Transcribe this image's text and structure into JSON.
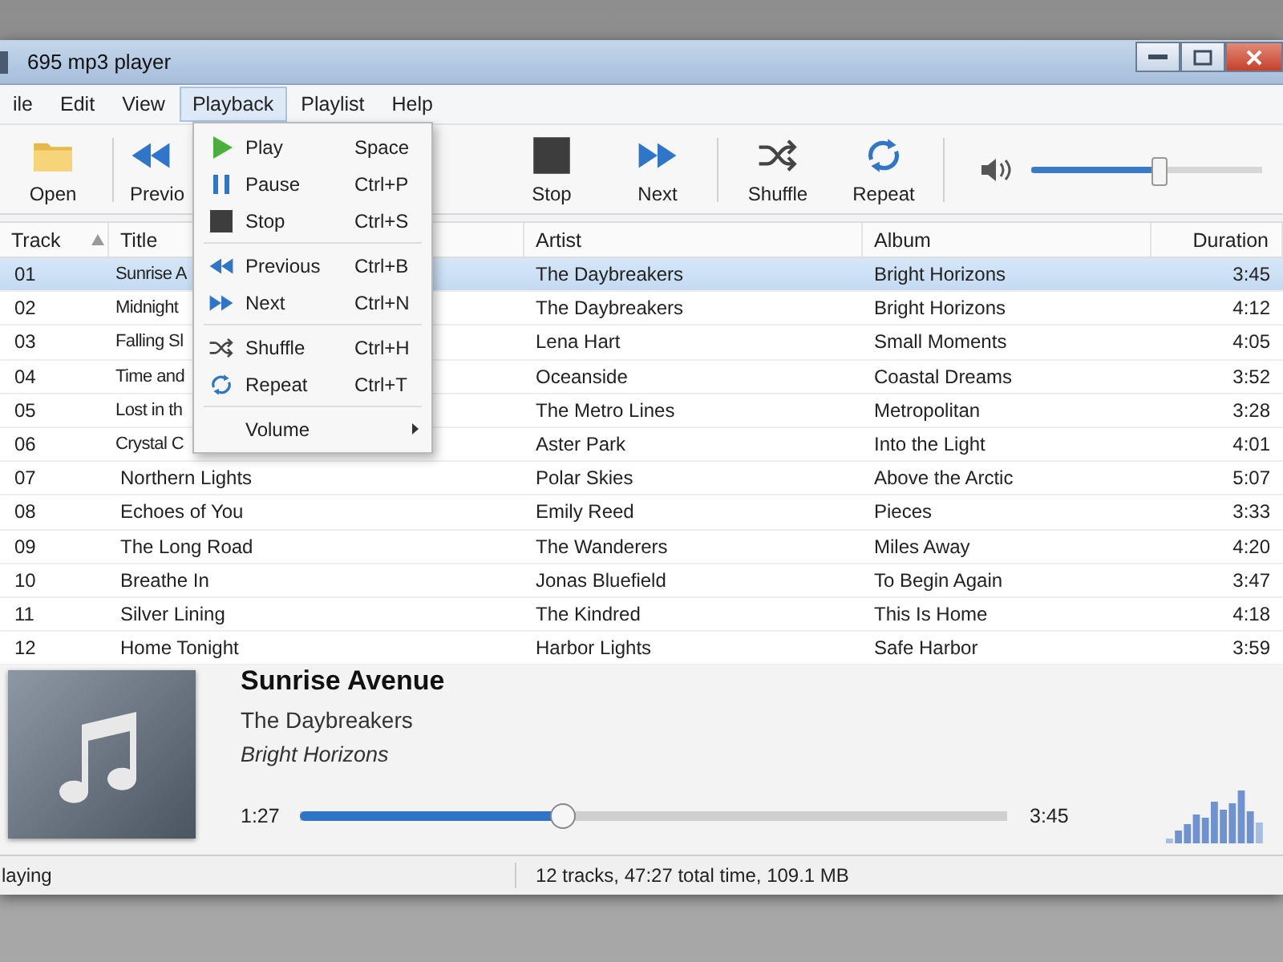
{
  "window": {
    "title": "695 mp3 player"
  },
  "menu_bar": [
    {
      "label": "ile",
      "selected": false
    },
    {
      "label": "Edit",
      "selected": false
    },
    {
      "label": "View",
      "selected": false
    },
    {
      "label": "Playback",
      "selected": true
    },
    {
      "label": "Playlist",
      "selected": false
    },
    {
      "label": "Help",
      "selected": false
    }
  ],
  "toolbar": [
    {
      "label": "Open",
      "kind": "open"
    },
    {
      "label": "Previo",
      "kind": "previous"
    },
    {
      "label": "Stop",
      "kind": "stop"
    },
    {
      "label": "Next",
      "kind": "next"
    },
    {
      "label": "Shuffle",
      "kind": "shuffle"
    },
    {
      "label": "Repeat",
      "kind": "repeat"
    }
  ],
  "volume": {
    "level": 0.55
  },
  "playback_menu": [
    {
      "kind": "play",
      "label": "Play",
      "shortcut": "Space"
    },
    {
      "kind": "pause",
      "label": "Pause",
      "shortcut": "Ctrl+P"
    },
    {
      "kind": "stop",
      "label": "Stop",
      "shortcut": "Ctrl+S"
    },
    {
      "kind": "separator"
    },
    {
      "kind": "previous",
      "label": "Previous",
      "shortcut": "Ctrl+B"
    },
    {
      "kind": "next",
      "label": "Next",
      "shortcut": "Ctrl+N"
    },
    {
      "kind": "separator"
    },
    {
      "kind": "shuffle",
      "label": "Shuffle",
      "shortcut": "Ctrl+H"
    },
    {
      "kind": "repeat",
      "label": "Repeat",
      "shortcut": "Ctrl+T"
    },
    {
      "kind": "separator"
    },
    {
      "kind": "submenu",
      "label": "Volume"
    }
  ],
  "table": {
    "columns": [
      "Track",
      "Title",
      "Artist",
      "Album",
      "Duration"
    ],
    "rows": [
      {
        "track": "01",
        "title": "Sunrise A",
        "artist": "The Daybreakers",
        "album": "Bright Horizons",
        "duration": "3:45",
        "selected": true
      },
      {
        "track": "02",
        "title": "Midnight",
        "artist": "The Daybreakers",
        "album": "Bright Horizons",
        "duration": "4:12",
        "selected": false
      },
      {
        "track": "03",
        "title": "Falling Sl",
        "artist": "Lena Hart",
        "album": "Small Moments",
        "duration": "4:05",
        "selected": false
      },
      {
        "track": "04",
        "title": "Time and",
        "artist": "Oceanside",
        "album": "Coastal Dreams",
        "duration": "3:52",
        "selected": false
      },
      {
        "track": "05",
        "title": "Lost in th",
        "artist": "The Metro Lines",
        "album": "Metropolitan",
        "duration": "3:28",
        "selected": false
      },
      {
        "track": "06",
        "title": "Crystal C",
        "artist": "Aster Park",
        "album": "Into the Light",
        "duration": "4:01",
        "selected": false
      },
      {
        "track": "07",
        "title": "Northern Lights",
        "artist": "Polar Skies",
        "album": "Above the Arctic",
        "duration": "5:07",
        "selected": false
      },
      {
        "track": "08",
        "title": "Echoes of You",
        "artist": "Emily Reed",
        "album": "Pieces",
        "duration": "3:33",
        "selected": false
      },
      {
        "track": "09",
        "title": "The Long Road",
        "artist": "The Wanderers",
        "album": "Miles Away",
        "duration": "4:20",
        "selected": false
      },
      {
        "track": "10",
        "title": "Breathe In",
        "artist": "Jonas Bluefield",
        "album": "To Begin Again",
        "duration": "3:47",
        "selected": false
      },
      {
        "track": "11",
        "title": "Silver Lining",
        "artist": "The Kindred",
        "album": "This Is Home",
        "duration": "4:18",
        "selected": false
      },
      {
        "track": "12",
        "title": "Home Tonight",
        "artist": "Harbor Lights",
        "album": "Safe Harbor",
        "duration": "3:59",
        "selected": false
      }
    ]
  },
  "now_playing": {
    "title": "Sunrise Avenue",
    "artist": "The Daybreakers",
    "album": "Bright Horizons",
    "elapsed": "1:27",
    "total": "3:45",
    "level": 0.37
  },
  "status_bar": {
    "state": "laying",
    "summary": "12 tracks, 47:27 total time, 109.1 MB"
  }
}
